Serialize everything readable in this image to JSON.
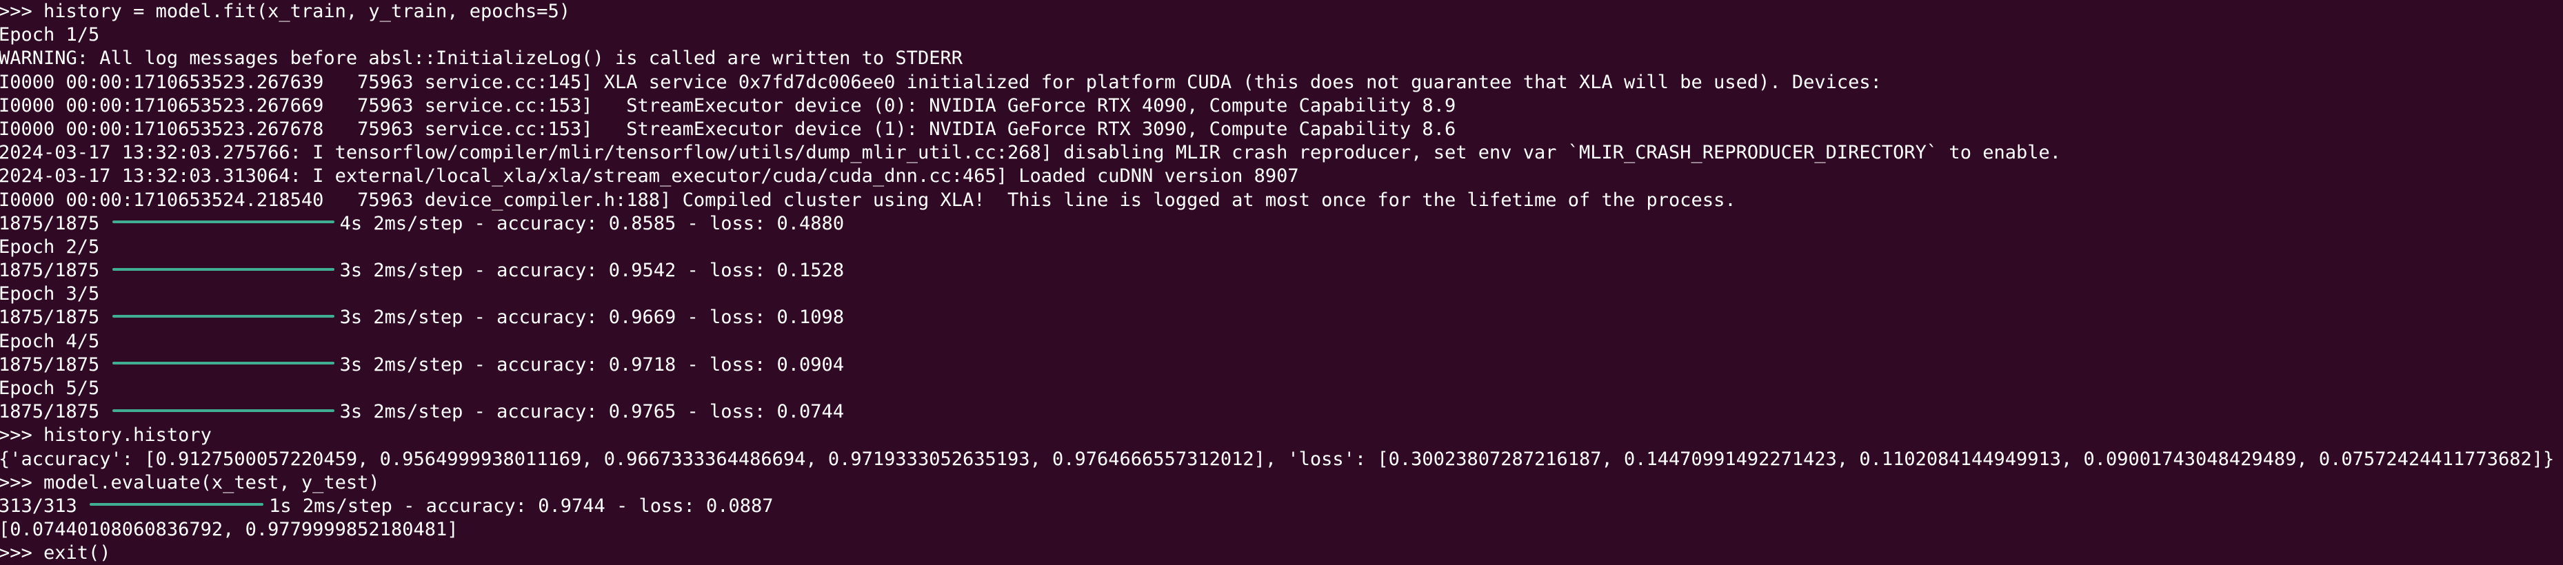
{
  "terminal": {
    "lines": [
      {
        "text": ">>> history = model.fit(x_train, y_train, epochs=5)"
      },
      {
        "text": "Epoch 1/5"
      },
      {
        "text": "WARNING: All log messages before absl::InitializeLog() is called are written to STDERR"
      },
      {
        "text": "I0000 00:00:1710653523.267639   75963 service.cc:145] XLA service 0x7fd7dc006ee0 initialized for platform CUDA (this does not guarantee that XLA will be used). Devices:"
      },
      {
        "text": "I0000 00:00:1710653523.267669   75963 service.cc:153]   StreamExecutor device (0): NVIDIA GeForce RTX 4090, Compute Capability 8.9"
      },
      {
        "text": "I0000 00:00:1710653523.267678   75963 service.cc:153]   StreamExecutor device (1): NVIDIA GeForce RTX 3090, Compute Capability 8.6"
      },
      {
        "text": "2024-03-17 13:32:03.275766: I tensorflow/compiler/mlir/tensorflow/utils/dump_mlir_util.cc:268] disabling MLIR crash reproducer, set env var `MLIR_CRASH_REPRODUCER_DIRECTORY` to enable."
      },
      {
        "text": "2024-03-17 13:32:03.313064: I external/local_xla/xla/stream_executor/cuda/cuda_dnn.cc:465] Loaded cuDNN version 8907"
      },
      {
        "text": "I0000 00:00:1710653524.218540   75963 device_compiler.h:188] Compiled cluster using XLA!  This line is logged at most once for the lifetime of the process."
      },
      {
        "prefix": "1875/1875",
        "progress": 1.0,
        "bar": "long",
        "suffix": "4s 2ms/step - accuracy: 0.8585 - loss: 0.4880"
      },
      {
        "text": "Epoch 2/5"
      },
      {
        "prefix": "1875/1875",
        "progress": 1.0,
        "bar": "long",
        "suffix": "3s 2ms/step - accuracy: 0.9542 - loss: 0.1528"
      },
      {
        "text": "Epoch 3/5"
      },
      {
        "prefix": "1875/1875",
        "progress": 1.0,
        "bar": "long",
        "suffix": "3s 2ms/step - accuracy: 0.9669 - loss: 0.1098"
      },
      {
        "text": "Epoch 4/5"
      },
      {
        "prefix": "1875/1875",
        "progress": 1.0,
        "bar": "long",
        "suffix": "3s 2ms/step - accuracy: 0.9718 - loss: 0.0904"
      },
      {
        "text": "Epoch 5/5"
      },
      {
        "prefix": "1875/1875",
        "progress": 1.0,
        "bar": "long",
        "suffix": "3s 2ms/step - accuracy: 0.9765 - loss: 0.0744"
      },
      {
        "text": ">>> history.history"
      },
      {
        "text": "{'accuracy': [0.9127500057220459, 0.9564999938011169, 0.9667333364486694, 0.9719333052635193, 0.9764666557312012], 'loss': [0.30023807287216187, 0.14470991492271423, 0.1102084144949913, 0.09001743048429489, 0.07572424411773682]}"
      },
      {
        "text": ">>> model.evaluate(x_test, y_test)"
      },
      {
        "prefix": "313/313",
        "progress": 1.0,
        "bar": "short",
        "suffix": "1s 2ms/step - accuracy: 0.9744 - loss: 0.0887"
      },
      {
        "text": "[0.07440108060836792, 0.9779999852180481]"
      },
      {
        "text": ">>> exit()"
      }
    ]
  },
  "colors": {
    "background": "#300a24",
    "text": "#ffffff",
    "progress_bar": "#3fae92"
  }
}
